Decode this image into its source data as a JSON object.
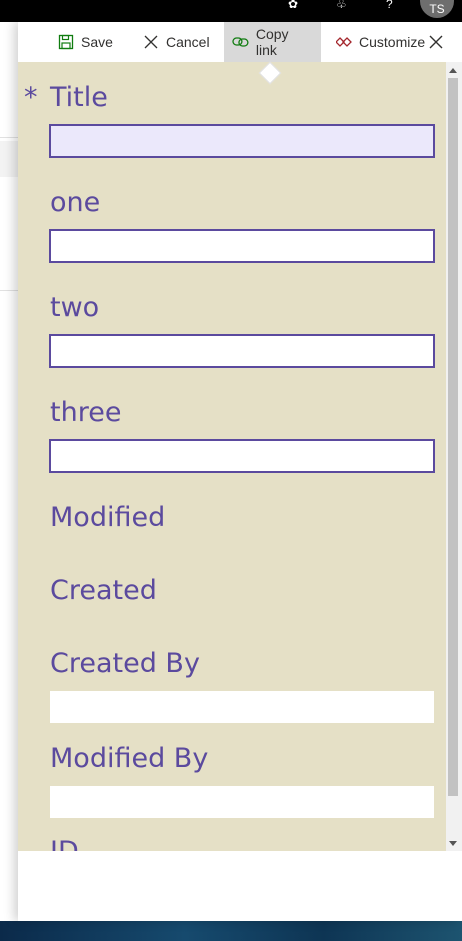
{
  "suite_bar": {
    "avatar_initials": "TS"
  },
  "command_bar": {
    "save_label": "Save",
    "cancel_label": "Cancel",
    "copy_link_label": "Copy link",
    "customize_label": "Customize"
  },
  "form": {
    "required_marker": "*",
    "fields": [
      {
        "label": "Title",
        "value": "",
        "required": true
      },
      {
        "label": "one",
        "value": ""
      },
      {
        "label": "two",
        "value": ""
      },
      {
        "label": "three",
        "value": ""
      }
    ],
    "readonly": [
      {
        "label": "Modified",
        "value": ""
      },
      {
        "label": "Created",
        "value": ""
      },
      {
        "label": "Created By",
        "value": ""
      },
      {
        "label": "Modified By",
        "value": ""
      },
      {
        "label": "ID",
        "value": ""
      }
    ]
  },
  "colors": {
    "label": "#5b4a9e",
    "form_bg": "#e5e0c6",
    "focused_input": "#ebe8fb",
    "save_icon": "#107c10",
    "copy_icon": "#107c10",
    "customize_icon": "#a4262c"
  }
}
